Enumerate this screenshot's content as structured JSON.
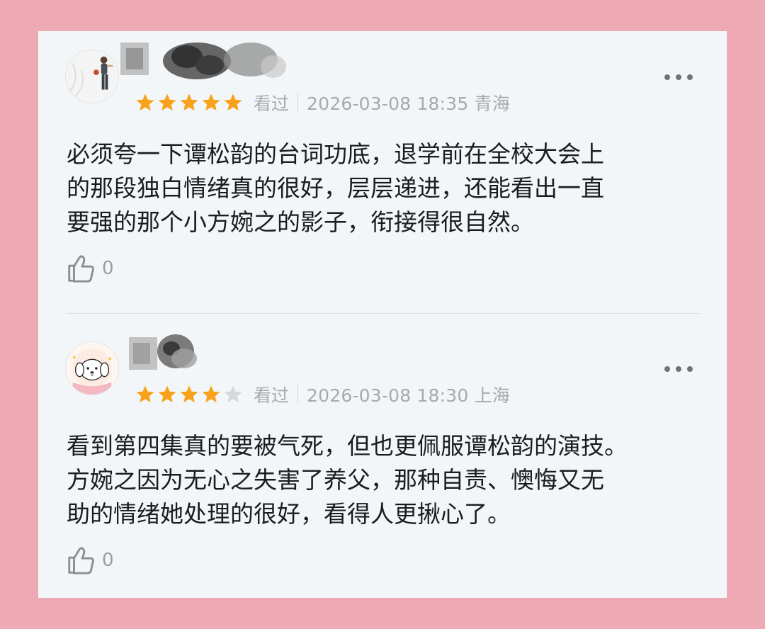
{
  "reviews": [
    {
      "rating": 5,
      "status": "看过",
      "time_location": "2026-03-08 18:35 青海",
      "content_lines": [
        "必须夸一下谭松韵的台词功底，退学前在全校大会上",
        "的那段独白情绪真的很好，层层递进，还能看出一直",
        "要强的那个小方婉之的影子，衔接得很自然。"
      ],
      "like_count": "0"
    },
    {
      "rating": 4,
      "status": "看过",
      "time_location": "2026-03-08 18:30 上海",
      "content_lines": [
        "看到第四集真的要被气死，但也更佩服谭松韵的演技。",
        "方婉之因为无心之失害了养父，那种自责、懊悔又无",
        "助的情绪她处理的很好，看得人更揪心了。"
      ],
      "like_count": "0"
    }
  ],
  "colors": {
    "star_filled": "#f8a11a",
    "star_empty": "#d6d8db",
    "background": "#eeaab4",
    "card": "#f3f6f8"
  },
  "icons": {
    "like": "thumb-up-icon",
    "more": "more-dots-icon",
    "star": "star-icon"
  }
}
